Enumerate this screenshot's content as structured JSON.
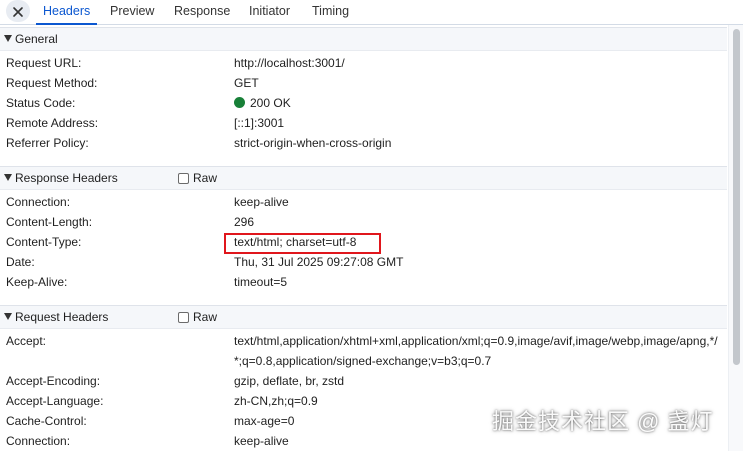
{
  "tabs": [
    "Headers",
    "Preview",
    "Response",
    "Initiator",
    "Timing"
  ],
  "active_tab": "Headers",
  "general": {
    "title": "General",
    "rows": [
      {
        "key": "Request URL:",
        "value": "http://localhost:3001/"
      },
      {
        "key": "Request Method:",
        "value": "GET"
      },
      {
        "key": "Status Code:",
        "value": "200 OK",
        "status_color": "#188038"
      },
      {
        "key": "Remote Address:",
        "value": "[::1]:3001"
      },
      {
        "key": "Referrer Policy:",
        "value": "strict-origin-when-cross-origin"
      }
    ]
  },
  "response_headers": {
    "title": "Response Headers",
    "raw_label": "Raw",
    "rows": [
      {
        "key": "Connection:",
        "value": "keep-alive"
      },
      {
        "key": "Content-Length:",
        "value": "296"
      },
      {
        "key": "Content-Type:",
        "value": "text/html; charset=utf-8"
      },
      {
        "key": "Date:",
        "value": "Thu, 31 Jul 2025 09:27:08 GMT"
      },
      {
        "key": "Keep-Alive:",
        "value": "timeout=5"
      }
    ]
  },
  "request_headers": {
    "title": "Request Headers",
    "raw_label": "Raw",
    "rows": [
      {
        "key": "Accept:",
        "value": "text/html,application/xhtml+xml,application/xml;q=0.9,image/avif,image/webp,image/apng,*/*;q=0.8,application/signed-exchange;v=b3;q=0.7"
      },
      {
        "key": "Accept-Encoding:",
        "value": "gzip, deflate, br, zstd"
      },
      {
        "key": "Accept-Language:",
        "value": "zh-CN,zh;q=0.9"
      },
      {
        "key": "Cache-Control:",
        "value": "max-age=0"
      },
      {
        "key": "Connection:",
        "value": "keep-alive"
      }
    ]
  },
  "watermark": "掘金技术社区 @ 盏灯",
  "colors": {
    "accent": "#0b57d0",
    "status_ok": "#188038",
    "highlight": "#e0161c"
  }
}
